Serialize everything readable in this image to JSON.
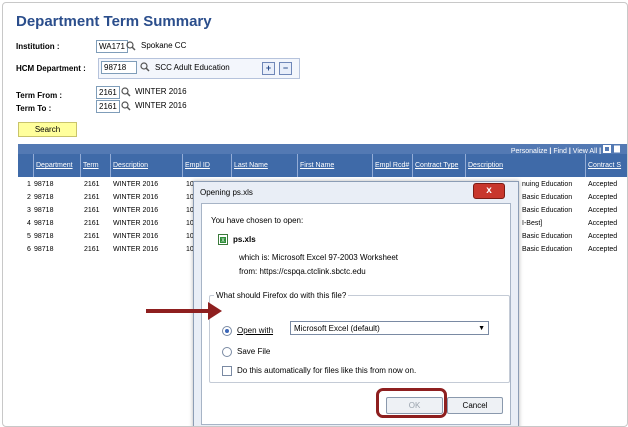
{
  "page": {
    "title": "Department Term Summary"
  },
  "form": {
    "institution_label": "Institution :",
    "institution_value": "WA171",
    "institution_desc": "Spokane CC",
    "hcm_label": "HCM Department :",
    "hcm_value": "98718",
    "hcm_desc": "SCC Adult Education",
    "plus": "+",
    "minus": "−",
    "term_from_label": "Term From :",
    "term_from_value": "2161",
    "term_from_desc": "WINTER 2016",
    "term_to_label": "Term To :",
    "term_to_value": "2161",
    "term_to_desc": "WINTER 2016",
    "search_label": "Search"
  },
  "grid": {
    "links": {
      "personalize": "Personalize",
      "sep1": " | ",
      "find": "Find",
      "sep2": " | ",
      "viewall": "View All",
      "sep3": " | "
    },
    "columns": [
      "Department",
      "Term",
      "Description",
      "Empl ID",
      "Last Name",
      "First Name",
      "Empl Rcd#",
      "Contract Type",
      "Description",
      "Contract S"
    ],
    "rows": [
      {
        "num": "1",
        "dept": "98718",
        "term": "2161",
        "desc": "WINTER 2016",
        "empl": "10",
        "desc2": "nuing Education",
        "status": "Accepted"
      },
      {
        "num": "2",
        "dept": "98718",
        "term": "2161",
        "desc": "WINTER 2016",
        "empl": "10",
        "desc2": "Basic Education",
        "status": "Accepted"
      },
      {
        "num": "3",
        "dept": "98718",
        "term": "2161",
        "desc": "WINTER 2016",
        "empl": "10",
        "desc2": "Basic Education",
        "status": "Accepted"
      },
      {
        "num": "4",
        "dept": "98718",
        "term": "2161",
        "desc": "WINTER 2016",
        "empl": "10",
        "desc2": "I-Best]",
        "status": "Accepted"
      },
      {
        "num": "5",
        "dept": "98718",
        "term": "2161",
        "desc": "WINTER 2016",
        "empl": "10",
        "desc2": "Basic Education",
        "status": "Accepted"
      },
      {
        "num": "6",
        "dept": "98718",
        "term": "2161",
        "desc": "WINTER 2016",
        "empl": "10",
        "desc2": "Basic Education",
        "status": "Accepted"
      }
    ]
  },
  "dialog": {
    "title": "Opening ps.xls",
    "close": "x",
    "intro": "You have chosen to open:",
    "filename": "ps.xls",
    "which_is": "which is:  Microsoft Excel 97-2003 Worksheet",
    "from": "from:  https://cspqa.ctclink.sbctc.edu",
    "question": "What should Firefox do with this file?",
    "open_with_label": "Open with",
    "open_with_value": "Microsoft Excel (default)",
    "save_label": "Save File",
    "auto_label": "Do this automatically for files like this from now on.",
    "ok": "OK",
    "cancel": "Cancel"
  },
  "colors": {
    "accent": "#8e1f1f",
    "header_blue": "#3f6aa8",
    "title_blue": "#2b4e8c"
  }
}
